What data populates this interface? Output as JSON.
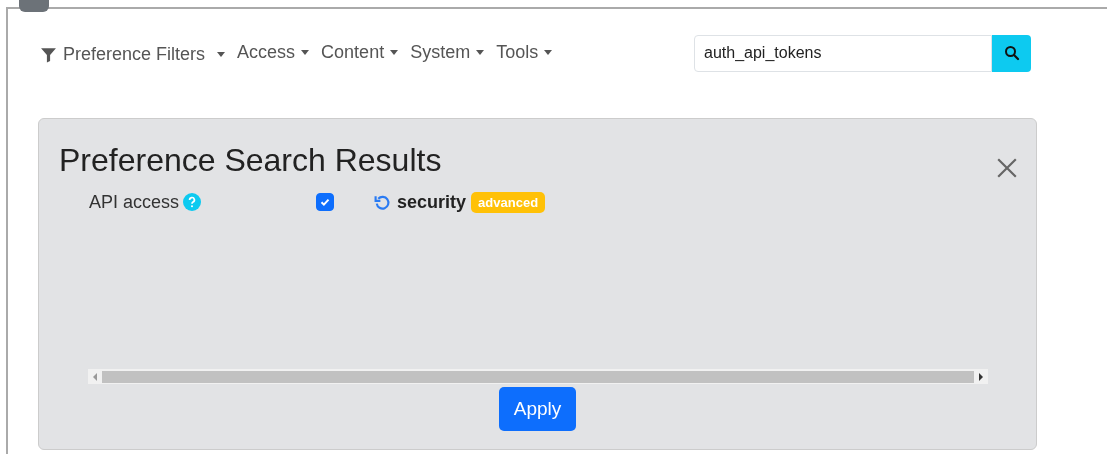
{
  "nav": {
    "filters": {
      "label": "Preference Filters"
    },
    "menus": [
      {
        "label": "Access"
      },
      {
        "label": "Content"
      },
      {
        "label": "System"
      },
      {
        "label": "Tools"
      }
    ]
  },
  "search": {
    "value": "auth_api_tokens"
  },
  "panel": {
    "title": "Preference Search Results",
    "rows": [
      {
        "label": "API access",
        "checked": true,
        "section": "security",
        "badge": "advanced"
      }
    ],
    "apply_button": "Apply"
  }
}
